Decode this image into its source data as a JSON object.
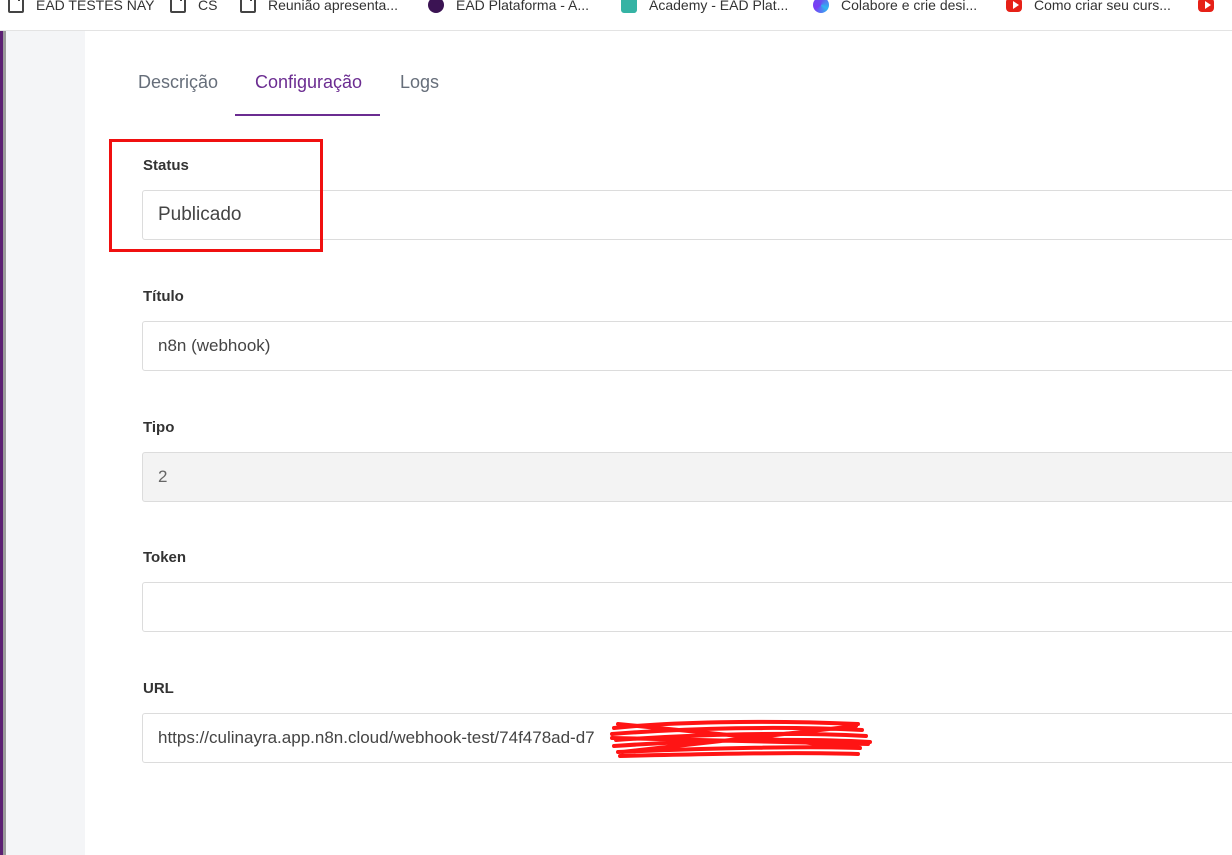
{
  "bookmarks": [
    {
      "label": "EAD TESTES NAY",
      "icon": "folder-icon"
    },
    {
      "label": "CS",
      "icon": "folder-icon"
    },
    {
      "label": "Reunião apresenta...",
      "icon": "folder-icon"
    },
    {
      "label": "EAD Plataforma - A...",
      "icon": "ead-logo-icon"
    },
    {
      "label": "Academy - EAD Plat...",
      "icon": "academy-logo-icon"
    },
    {
      "label": "Colabore e crie desi...",
      "icon": "canva-logo-icon"
    },
    {
      "label": "Como criar seu curs...",
      "icon": "youtube-icon"
    }
  ],
  "tabs": [
    {
      "label": "Descrição"
    },
    {
      "label": "Configuração",
      "active": true
    },
    {
      "label": "Logs"
    }
  ],
  "form": {
    "status_label": "Status",
    "status_value": "Publicado",
    "title_label": "Título",
    "title_value": "n8n (webhook)",
    "type_label": "Tipo",
    "type_value": "2",
    "token_label": "Token",
    "token_value": "",
    "url_label": "URL",
    "url_value": "https://culinayra.app.n8n.cloud/webhook-test/74f478ad-d7"
  },
  "colors": {
    "accent": "#6b2c91",
    "annotation": "#f01010"
  }
}
